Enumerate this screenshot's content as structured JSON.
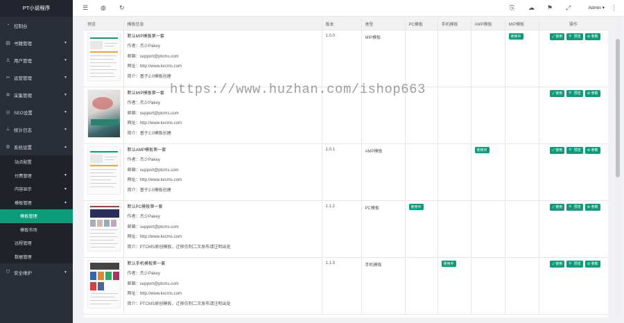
{
  "app": {
    "title": "PT小说程序"
  },
  "sidebar": {
    "items": [
      {
        "label": "控制台",
        "icon": "dashboard-icon",
        "glyph": "◔",
        "arrow": ""
      },
      {
        "label": "书籍管理",
        "icon": "book-icon",
        "glyph": "▤",
        "arrow": "▼"
      },
      {
        "label": "用户管理",
        "icon": "user-icon",
        "glyph": "♙",
        "arrow": "▼"
      },
      {
        "label": "运营管理",
        "icon": "operation-icon",
        "glyph": "✂",
        "arrow": "▼"
      },
      {
        "label": "采集管理",
        "icon": "collect-icon",
        "glyph": "✲",
        "arrow": "▼"
      },
      {
        "label": "SEO设置",
        "icon": "seo-icon",
        "glyph": "◎",
        "arrow": "▼"
      },
      {
        "label": "统计日志",
        "icon": "stats-icon",
        "glyph": "⟂",
        "arrow": "▼"
      },
      {
        "label": "系统设置",
        "icon": "settings-icon",
        "glyph": "⚙",
        "arrow": "▲"
      }
    ],
    "system_sub": [
      {
        "label": "站点配置",
        "arrow": ""
      },
      {
        "label": "付费管理",
        "arrow": "▼"
      },
      {
        "label": "内容显示",
        "arrow": "▼"
      },
      {
        "label": "模板管理",
        "arrow": "▲"
      }
    ],
    "template_sub": [
      {
        "label": "模板管理",
        "active": true
      },
      {
        "label": "模板市场",
        "active": false
      }
    ],
    "system_sub2": [
      {
        "label": "远程管理"
      },
      {
        "label": "数据管理"
      }
    ],
    "security": {
      "label": "安全维护",
      "icon": "shield-icon",
      "glyph": "⛉",
      "arrow": "▼"
    }
  },
  "topbar": {
    "menu_icon": "☰",
    "globe_icon": "◍",
    "refresh_icon": "↻",
    "icons_right": [
      "⎘",
      "☁",
      "⚑",
      "⤢"
    ],
    "admin": "Admin ▾",
    "more_icon": "⋮"
  },
  "table": {
    "headers": [
      "预览",
      "模板信息",
      "版本",
      "类型",
      "PC模板",
      "手机模板",
      "AMP模板",
      "MIP模板",
      "操作"
    ],
    "rows": [
      {
        "name": "默认MIP模板第一套",
        "author": "作者：杰少Pakey",
        "email": "邮箱：support@ptcms.com",
        "site": "网址：http://www.kxcms.com",
        "intro": "简介：基于2.0模板创建",
        "version": "1.0.0",
        "type": "MIP模板",
        "pc": "",
        "mobile": "",
        "amp": "",
        "mip": "使用中"
      },
      {
        "name": "默认MIP模板第一套",
        "author": "作者：杰少Pakey",
        "email": "邮箱：support@ptcms.com",
        "site": "网址：http://www.kxcms.com",
        "intro": "简介：基于2.0模板创建",
        "version": "",
        "type": "",
        "pc": "",
        "mobile": "",
        "amp": "",
        "mip": ""
      },
      {
        "name": "默认AMP模板第一套",
        "author": "作者：杰少Pakey",
        "email": "邮箱：support@ptcms.com",
        "site": "网址：http://www.kxcms.com",
        "intro": "简介：基于2.0模板创建",
        "version": "1.0.1",
        "type": "AMP模板",
        "pc": "",
        "mobile": "",
        "amp": "使用中",
        "mip": ""
      },
      {
        "name": "默认PC模板第一套",
        "author": "作者：杰少Pakey",
        "email": "邮箱：support@ptcms.com",
        "site": "网址：http://www.kxcms.com",
        "intro": "简介：PTCMS原创模板，迁移仿制二次发布请注明出处",
        "version": "1.1.2",
        "type": "PC模板",
        "pc": "使用中",
        "mobile": "",
        "amp": "",
        "mip": ""
      },
      {
        "name": "默认手机模板第一套",
        "author": "作者：杰少Pakey",
        "email": "邮箱：support@ptcms.com",
        "site": "网址：http://www.kxcms.com",
        "intro": "简介：PTCMS原创模板，迁移仿制二次发布请注明出处",
        "version": "1.1.3",
        "type": "手机模板",
        "pc": "",
        "mobile": "使用中",
        "amp": "",
        "mip": ""
      }
    ],
    "ops": {
      "use": "✓ 使用",
      "preview": "🔍 预览",
      "params": "⚙ 参数"
    }
  },
  "watermark": "https://www.huzhan.com/ishop663",
  "colors": {
    "sidebar": "#2a2e37",
    "accent": "#0b9d7a"
  }
}
